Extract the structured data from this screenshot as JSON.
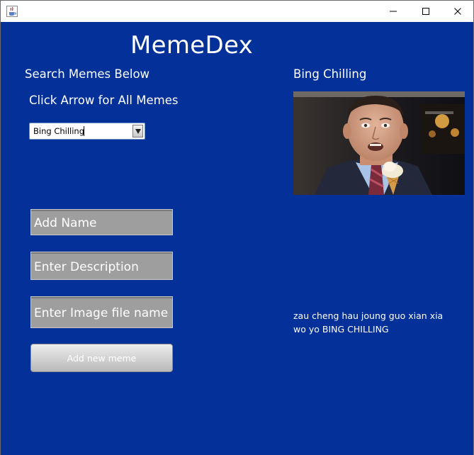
{
  "window": {
    "icons": {
      "app": "java-cup-icon",
      "minimize": "minimize-icon",
      "maximize": "maximize-icon",
      "close": "close-icon"
    }
  },
  "app": {
    "title": "MemeDex",
    "search_label": "Search Memes Below",
    "arrow_label": "Click Arrow for All Memes",
    "selected_meme": "Bing Chilling"
  },
  "form": {
    "name_field": "Add Name",
    "description_field": "Enter Description",
    "image_field": "Enter Image file name",
    "add_button": "Add new meme"
  },
  "preview": {
    "name": "Bing Chilling",
    "description": "zau cheng hau joung guo xian xia wo yo BING CHILLING",
    "image_icon": "meme-photo"
  },
  "colors": {
    "background": "#04309a",
    "text": "#ffffff",
    "field": "#9e9e9e",
    "button": "#c9c9c9"
  }
}
